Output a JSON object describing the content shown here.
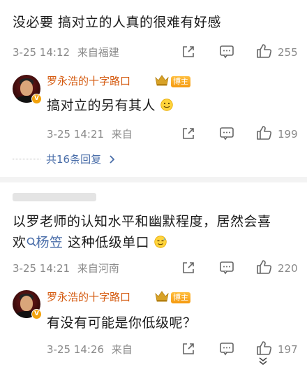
{
  "comment1": {
    "text": "没必要   搞对立的人真的很难有好感",
    "time": "3-25 14:12",
    "location": "来自福建",
    "likes": "255",
    "reply": {
      "author": "罗永浩的十字路口",
      "badge": "博主",
      "text": "搞对立的另有其人",
      "time": "3-25 14:21",
      "location": "来自",
      "likes": "199"
    },
    "more_replies": "共16条回复"
  },
  "comment2": {
    "text_line1": "以罗老师的认知水平和幽默程度，居然会喜",
    "text_line2_prefix": "欢",
    "mention": "杨笠",
    "text_line2_suffix": " 这种低级单口",
    "time": "3-25 14:21",
    "location": "来自河南",
    "likes": "220",
    "reply": {
      "author": "罗永浩的十字路口",
      "badge": "博主",
      "text": "有没有可能是你低级呢？",
      "time": "3-25 14:26",
      "location": "来自",
      "likes": "197"
    }
  },
  "icons": {
    "share": "share-icon",
    "comment": "comment-icon",
    "like": "thumbs-up-icon",
    "smile": "smile-emoji-icon",
    "sweat": "sweat-smile-emoji-icon",
    "search": "search-icon",
    "chevron": "chevron-right-icon",
    "expand": "double-chevron-down-icon",
    "crown": "crown-icon",
    "verified": "verified-v-icon"
  },
  "colors": {
    "author": "#d4590e",
    "link": "#4a6ea9",
    "meta": "#8a8a8a",
    "badge": "#f59a10"
  }
}
